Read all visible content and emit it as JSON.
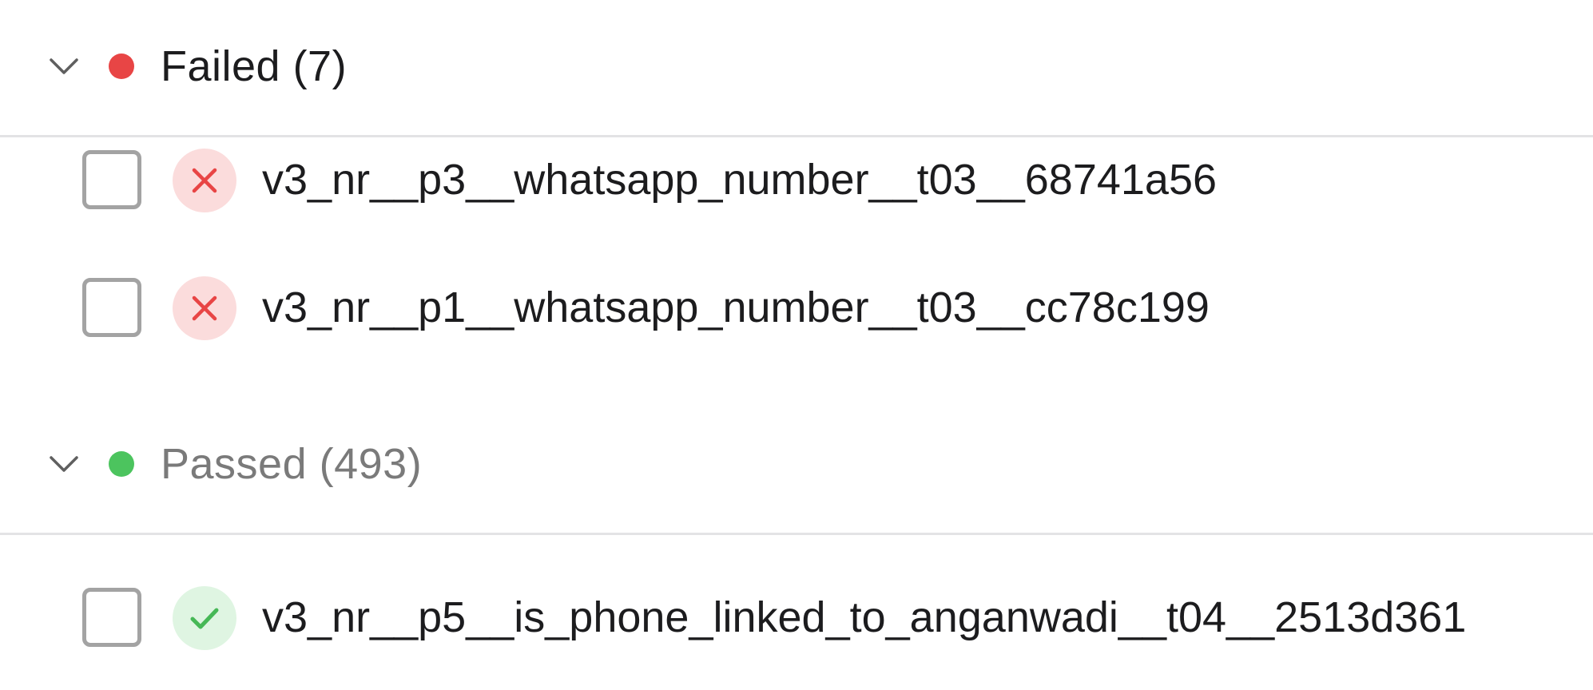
{
  "colors": {
    "failed_dot": "#e84545",
    "passed_dot": "#4cc45e",
    "failed_icon_bg": "#fbdcdc",
    "failed_icon_fg": "#e84545",
    "passed_icon_bg": "#dff5e2",
    "passed_icon_fg": "#46b856"
  },
  "groups": {
    "failed": {
      "title": "Failed (7)",
      "icon": "chevron-down-icon",
      "items": [
        {
          "name": "v3_nr__p3__whatsapp_number__t03__68741a56",
          "status_icon": "x-icon",
          "checked": false
        },
        {
          "name": "v3_nr__p1__whatsapp_number__t03__cc78c199",
          "status_icon": "x-icon",
          "checked": false
        }
      ]
    },
    "passed": {
      "title": "Passed (493)",
      "icon": "chevron-down-icon",
      "items": [
        {
          "name": "v3_nr__p5__is_phone_linked_to_anganwadi__t04__2513d361",
          "status_icon": "check-icon",
          "checked": false
        }
      ]
    }
  }
}
